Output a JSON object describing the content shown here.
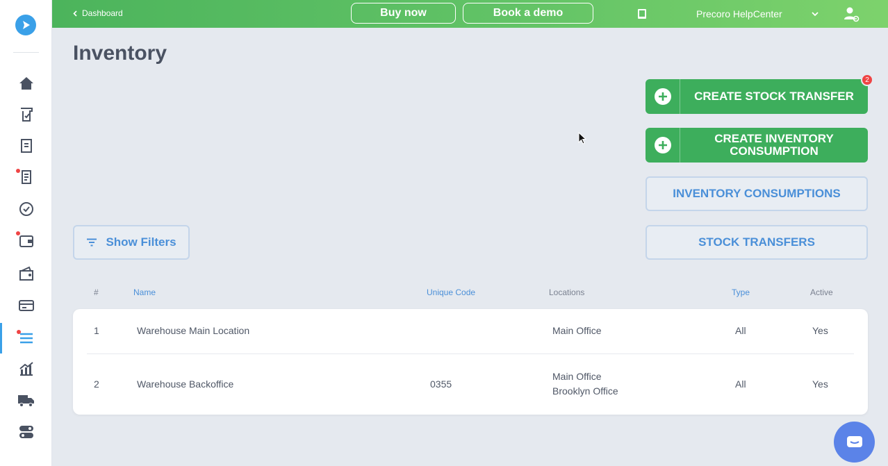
{
  "topbar": {
    "back_label": "Dashboard",
    "buy_label": "Buy now",
    "demo_label": "Book a demo",
    "help_label": "Precoro HelpCenter"
  },
  "page": {
    "title": "Inventory"
  },
  "actions": {
    "create_transfer": "CREATE STOCK TRANSFER",
    "create_transfer_badge": "2",
    "create_consumption": "CREATE INVENTORY CONSUMPTION",
    "consumptions": "INVENTORY CONSUMPTIONS",
    "transfers": "STOCK TRANSFERS"
  },
  "filters": {
    "label": "Show Filters"
  },
  "table": {
    "headers": {
      "num": "#",
      "name": "Name",
      "code": "Unique Code",
      "locations": "Locations",
      "type": "Type",
      "active": "Active"
    },
    "rows": [
      {
        "num": "1",
        "name": "Warehouse Main Location",
        "code": "",
        "locations": [
          "Main Office"
        ],
        "type": "All",
        "active": "Yes"
      },
      {
        "num": "2",
        "name": "Warehouse Backoffice",
        "code": "0355",
        "locations": [
          "Main Office",
          "Brooklyn Office"
        ],
        "type": "All",
        "active": "Yes"
      }
    ]
  },
  "colors": {
    "accent": "#4a8fd8",
    "green": "#3dae5c",
    "badge": "#ef4444"
  }
}
